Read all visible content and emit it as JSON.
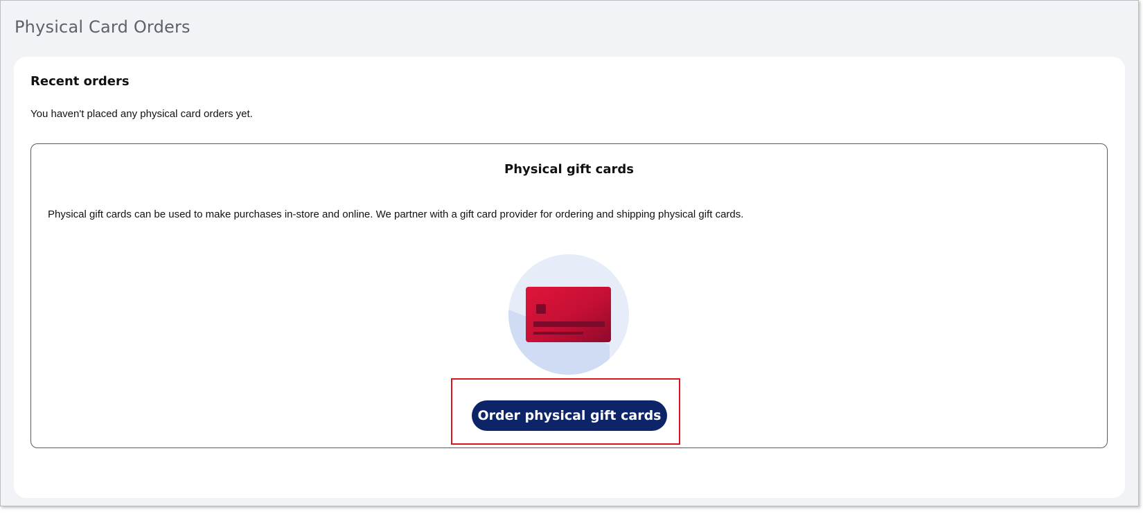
{
  "page": {
    "title": "Physical Card Orders"
  },
  "recent_orders": {
    "heading": "Recent orders",
    "empty_message": "You haven't placed any physical card orders yet."
  },
  "physical_gift_cards": {
    "title": "Physical gift cards",
    "description": "Physical gift cards can be used to make purchases in-store and online. We partner with a gift card provider for ordering and shipping physical gift cards.",
    "illustration_icon": "credit-card-icon",
    "order_button_label": "Order physical gift cards"
  },
  "colors": {
    "button_bg": "#0d2468",
    "card_red": "#d0123a",
    "illustration_circle": "#e6edf9",
    "highlight_border": "#d8151c"
  }
}
